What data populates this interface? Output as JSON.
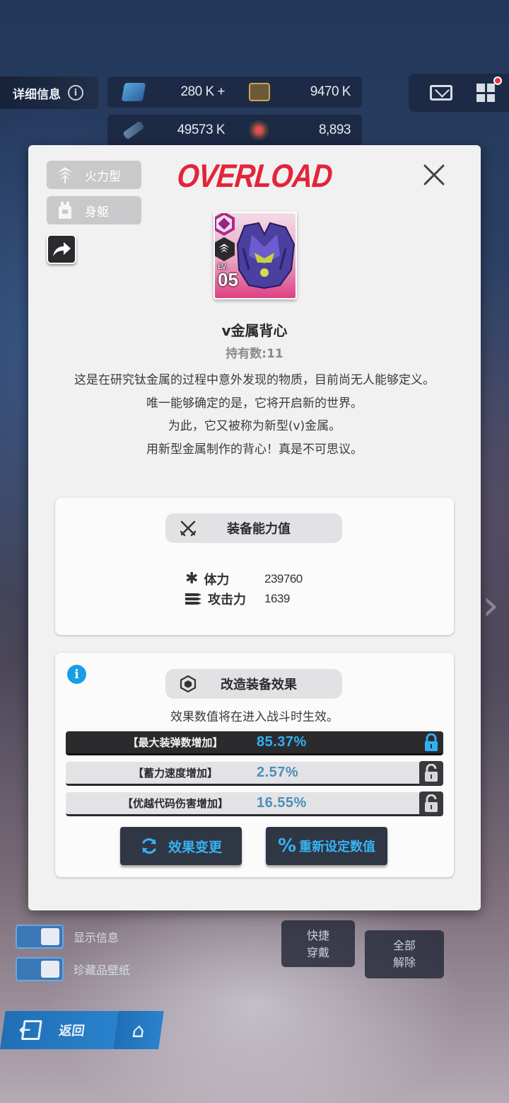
{
  "header": {
    "detail_label": "详细信息",
    "resources_row1": [
      "280 K +",
      "9470 K"
    ],
    "resources_row2": [
      "49573 K",
      "8,893"
    ]
  },
  "modal": {
    "brand": "OVERLOAD",
    "tags": [
      "火力型",
      "身躯"
    ],
    "item": {
      "level_label": "LV.",
      "level": "05",
      "name": "v金属背心",
      "own_count": "持有数:11",
      "description": [
        "这是在研究钛金属的过程中意外发现的物质，目前尚无人能够定义。",
        "唯一能够确定的是，它将开启新的世界。",
        "为此，它又被称为新型(v)金属。",
        "用新型金属制作的背心！真是不可思议。"
      ]
    },
    "stats_panel": {
      "title": "装备能力值",
      "stats": [
        {
          "name": "体力",
          "value": "239760",
          "icon": "asterisk-icon"
        },
        {
          "name": "攻击力",
          "value": "1639",
          "icon": "bullets-icon"
        }
      ]
    },
    "effects_panel": {
      "title": "改造装备效果",
      "notice": "效果数值将在进入战斗时生效。",
      "effects": [
        {
          "name": "【最大装弹数增加】",
          "value": "85.37%",
          "locked": true
        },
        {
          "name": "【蓄力速度增加】",
          "value": "2.57%",
          "locked": false
        },
        {
          "name": "【优越代码伤害增加】",
          "value": "16.55%",
          "locked": false
        }
      ],
      "buttons": {
        "change_effect": "效果变更",
        "reset_value": "重新设定数值"
      }
    }
  },
  "bottom": {
    "toggle_show_info": "显示信息",
    "toggle_wallpaper": "珍藏品壁纸",
    "quick_equip": [
      "快捷",
      "穿戴"
    ],
    "unequip_all": [
      "全部",
      "解除"
    ],
    "back": "返回"
  },
  "colors": {
    "brand_red": "#e3243a",
    "accent_blue": "#33b1f2",
    "panel_bg": "#f1f1f2"
  }
}
